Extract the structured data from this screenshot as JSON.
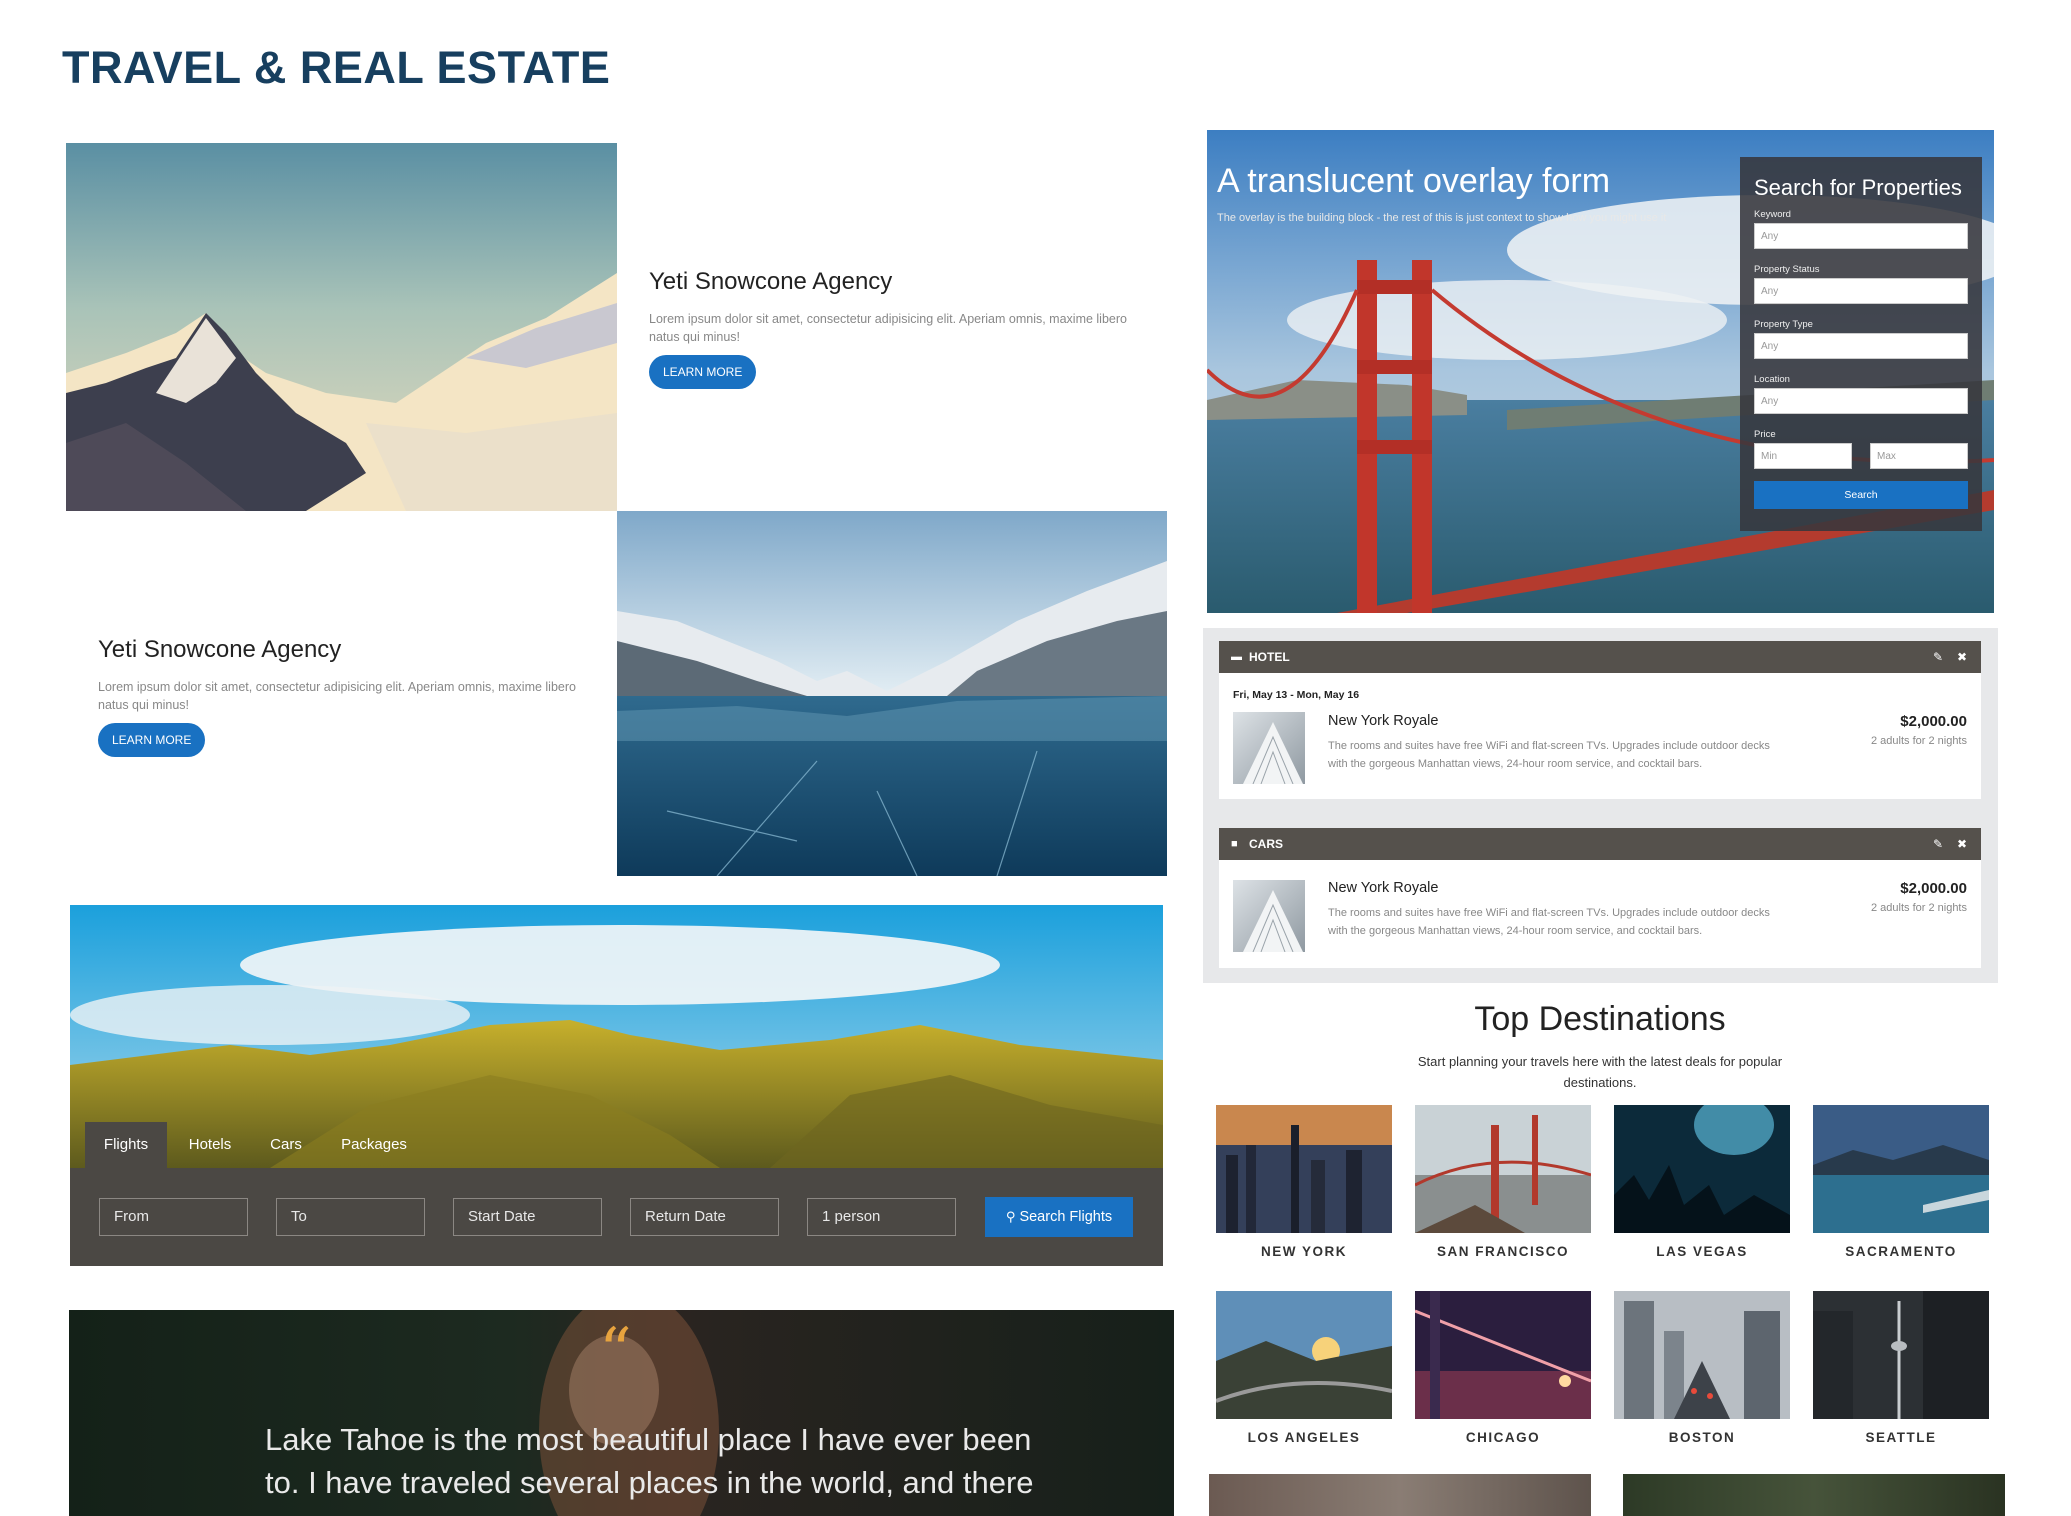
{
  "page": {
    "title": "TRAVEL & REAL ESTATE"
  },
  "agency_1": {
    "title": "Yeti Snowcone Agency",
    "text": "Lorem ipsum dolor sit amet, consectetur adipisicing elit. Aperiam omnis, maxime libero natus qui minus!",
    "button": "LEARN MORE"
  },
  "agency_2": {
    "title": "Yeti Snowcone Agency",
    "text": "Lorem ipsum dolor sit amet, consectetur adipisicing elit. Aperiam omnis, maxime libero natus qui minus!",
    "button": "LEARN MORE"
  },
  "overlay": {
    "headline": "A translucent overlay form",
    "subtext": "The overlay is the building block - the rest of this is just context to show how you might use it",
    "form": {
      "title": "Search for Properties",
      "keyword_label": "Keyword",
      "keyword_placeholder": "Any",
      "status_label": "Property Status",
      "status_placeholder": "Any",
      "type_label": "Property Type",
      "type_placeholder": "Any",
      "location_label": "Location",
      "location_placeholder": "Any",
      "price_label": "Price",
      "price_min": "Min",
      "price_max": "Max",
      "search_button": "Search"
    }
  },
  "itinerary": {
    "hotel": {
      "header": "HOTEL",
      "date": "Fri, May 13 - Mon, May 16",
      "name": "New York Royale",
      "description": "The rooms and suites have free WiFi and flat-screen TVs. Upgrades include outdoor decks with the gorgeous Manhattan views, 24-hour room service, and cocktail bars.",
      "price": "$2,000.00",
      "nights": "2 adults for 2 nights"
    },
    "cars": {
      "header": "CARS",
      "name": "New York Royale",
      "description": "The rooms and suites have free WiFi and flat-screen TVs. Upgrades include outdoor decks with the gorgeous Manhattan views, 24-hour room service, and cocktail bars.",
      "price": "$2,000.00",
      "nights": "2 adults for 2 nights"
    },
    "icons": [
      "bed-icon",
      "car-icon",
      "edit-icon",
      "close-icon"
    ]
  },
  "flight_search": {
    "tabs": [
      "Flights",
      "Hotels",
      "Cars",
      "Packages"
    ],
    "active_tab": "Flights",
    "from_placeholder": "From",
    "to_placeholder": "To",
    "start_placeholder": "Start Date",
    "return_placeholder": "Return Date",
    "travelers": "1 person",
    "search_button": "Search Flights"
  },
  "destinations": {
    "title": "Top Destinations",
    "subtitle_line1": "Start planning your travels here with the latest deals for popular",
    "subtitle_line2": "destinations.",
    "cities": [
      "NEW YORK",
      "SAN FRANCISCO",
      "LAS VEGAS",
      "SACRAMENTO",
      "LOS ANGELES",
      "CHICAGO",
      "BOSTON",
      "SEATTLE"
    ]
  },
  "testimonial": {
    "line1": "Lake Tahoe is the most beautiful place I have ever been",
    "line2": "to. I have traveled several places in the world, and there"
  },
  "colors": {
    "title": "#173f5f",
    "accent": "#1971c2",
    "bar": "#55514c",
    "quote_mark": "#e7a33e"
  }
}
